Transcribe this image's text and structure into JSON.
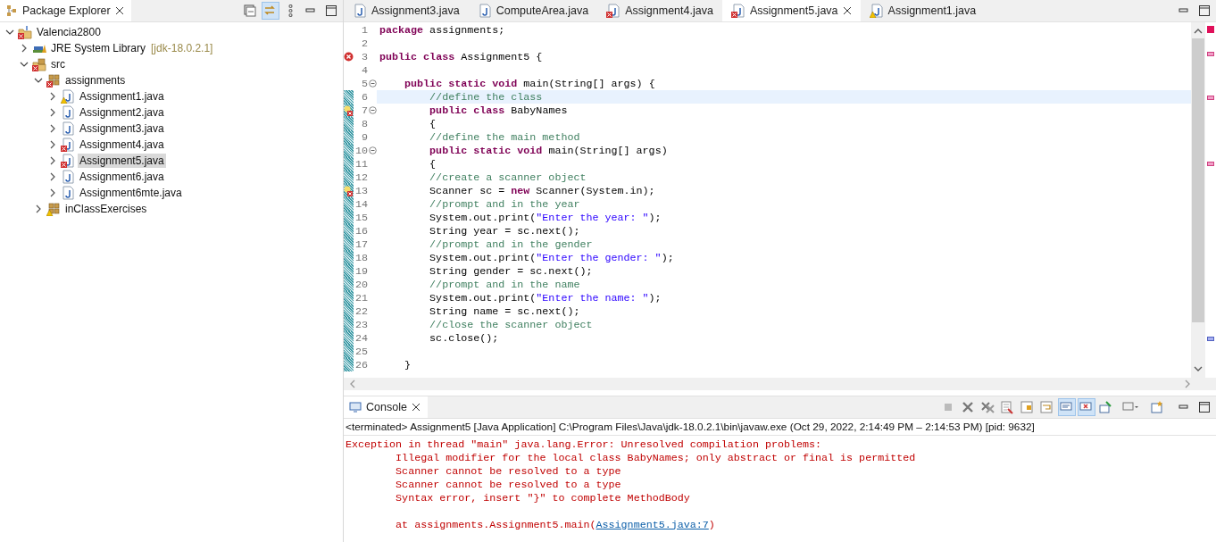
{
  "explorer": {
    "title": "Package Explorer",
    "toolbar": [
      {
        "kind": "collapse",
        "pressed": false
      },
      {
        "kind": "link",
        "pressed": true
      },
      {
        "kind": "menu",
        "pressed": false
      }
    ],
    "tree": [
      {
        "kind": "project",
        "label": "Valencia2800",
        "error": true,
        "warning": false,
        "expanded": true,
        "selected": false,
        "children": [
          {
            "kind": "library",
            "label": "JRE System Library",
            "suffix": "[jdk-18.0.2.1]",
            "error": false,
            "warning": false,
            "expanded": false,
            "selected": false
          },
          {
            "kind": "source",
            "label": "src",
            "error": true,
            "warning": false,
            "expanded": true,
            "selected": false,
            "children": [
              {
                "kind": "package",
                "label": "assignments",
                "error": true,
                "warning": false,
                "expanded": true,
                "selected": false,
                "children": [
                  {
                    "kind": "java",
                    "label": "Assignment1.java",
                    "error": false,
                    "warning": true,
                    "expanded": false,
                    "selected": false
                  },
                  {
                    "kind": "java",
                    "label": "Assignment2.java",
                    "error": false,
                    "warning": false,
                    "expanded": false,
                    "selected": false
                  },
                  {
                    "kind": "java",
                    "label": "Assignment3.java",
                    "error": false,
                    "warning": false,
                    "expanded": false,
                    "selected": false
                  },
                  {
                    "kind": "java",
                    "label": "Assignment4.java",
                    "error": true,
                    "warning": false,
                    "expanded": false,
                    "selected": false
                  },
                  {
                    "kind": "java",
                    "label": "Assignment5.java",
                    "error": true,
                    "warning": false,
                    "expanded": false,
                    "selected": true
                  },
                  {
                    "kind": "java",
                    "label": "Assignment6.java",
                    "error": false,
                    "warning": false,
                    "expanded": false,
                    "selected": false
                  },
                  {
                    "kind": "java",
                    "label": "Assignment6mte.java",
                    "error": false,
                    "warning": false,
                    "expanded": false,
                    "selected": false
                  }
                ]
              },
              {
                "kind": "package",
                "label": "inClassExercises",
                "error": false,
                "warning": true,
                "expanded": false,
                "selected": false
              }
            ]
          }
        ]
      }
    ]
  },
  "editor": {
    "tabs": [
      {
        "label": "Assignment3.java",
        "error": false,
        "warning": false,
        "selected": false
      },
      {
        "label": "ComputeArea.java",
        "error": false,
        "warning": false,
        "selected": false
      },
      {
        "label": "Assignment4.java",
        "error": true,
        "warning": false,
        "selected": false
      },
      {
        "label": "Assignment5.java",
        "error": true,
        "warning": false,
        "selected": true
      },
      {
        "label": "Assignment1.java",
        "error": false,
        "warning": true,
        "selected": false
      }
    ],
    "lines": [
      {
        "number": "1",
        "kind": "code",
        "text": "**package** assignments;",
        "error": false,
        "quickfix": false,
        "changed": false,
        "current": false,
        "fold": false
      },
      {
        "number": "2",
        "kind": "code",
        "error": false,
        "quickfix": false,
        "changed": false,
        "current": false,
        "fold": false
      },
      {
        "number": "3",
        "kind": "code",
        "text": "**public** **class** Assignment5 {",
        "error": true,
        "quickfix": false,
        "changed": false,
        "current": false,
        "fold": false
      },
      {
        "number": "4",
        "kind": "code",
        "error": false,
        "quickfix": false,
        "changed": false,
        "current": false,
        "fold": false
      },
      {
        "number": "5",
        "kind": "code",
        "text": "    **public** **static** **void** main(String[] args) {",
        "error": false,
        "quickfix": false,
        "changed": false,
        "current": false,
        "fold": true
      },
      {
        "number": "6",
        "kind": "comment",
        "text": "        //define the class",
        "error": false,
        "quickfix": false,
        "changed": true,
        "current": true,
        "fold": false
      },
      {
        "number": "7",
        "kind": "code",
        "text": "        **public** **class** BabyNames",
        "error": false,
        "quickfix": true,
        "changed": true,
        "current": false,
        "fold": true
      },
      {
        "number": "8",
        "kind": "code",
        "text": "        {",
        "error": false,
        "quickfix": false,
        "changed": true,
        "current": false,
        "fold": false
      },
      {
        "number": "9",
        "kind": "comment",
        "text": "        //define the main method",
        "error": false,
        "quickfix": false,
        "changed": true,
        "current": false,
        "fold": false
      },
      {
        "number": "10",
        "kind": "code",
        "text": "        **public** **static** **void** main(String[] args)",
        "error": false,
        "quickfix": false,
        "changed": true,
        "current": false,
        "fold": true
      },
      {
        "number": "11",
        "kind": "code",
        "text": "        {",
        "error": false,
        "quickfix": false,
        "changed": true,
        "current": false,
        "fold": false
      },
      {
        "number": "12",
        "kind": "comment",
        "text": "        //create a scanner object",
        "error": false,
        "quickfix": false,
        "changed": true,
        "current": false,
        "fold": false
      },
      {
        "number": "13",
        "kind": "code",
        "text": "        Scanner sc = **new** Scanner(System.in);",
        "error": false,
        "quickfix": true,
        "changed": true,
        "current": false,
        "fold": false
      },
      {
        "number": "14",
        "kind": "comment",
        "text": "        //prompt and in the year",
        "error": false,
        "quickfix": false,
        "changed": true,
        "current": false,
        "fold": false
      },
      {
        "number": "15",
        "kind": "code",
        "text": "        System.out.print(*\"Enter the year: \"*);",
        "error": false,
        "quickfix": false,
        "changed": true,
        "current": false,
        "fold": false
      },
      {
        "number": "16",
        "kind": "code",
        "text": "        String year = sc.next();",
        "error": false,
        "quickfix": false,
        "changed": true,
        "current": false,
        "fold": false
      },
      {
        "number": "17",
        "kind": "comment",
        "text": "        //prompt and in the gender",
        "error": false,
        "quickfix": false,
        "changed": true,
        "current": false,
        "fold": false
      },
      {
        "number": "18",
        "kind": "code",
        "text": "        System.out.print(*\"Enter the gender: \"*);",
        "error": false,
        "quickfix": false,
        "changed": true,
        "current": false,
        "fold": false
      },
      {
        "number": "19",
        "kind": "code",
        "text": "        String gender = sc.next();",
        "error": false,
        "quickfix": false,
        "changed": true,
        "current": false,
        "fold": false
      },
      {
        "number": "20",
        "kind": "comment",
        "text": "        //prompt and in the name",
        "error": false,
        "quickfix": false,
        "changed": true,
        "current": false,
        "fold": false
      },
      {
        "number": "21",
        "kind": "code",
        "text": "        System.out.print(*\"Enter the name: \"*);",
        "error": false,
        "quickfix": false,
        "changed": true,
        "current": false,
        "fold": false
      },
      {
        "number": "22",
        "kind": "code",
        "text": "        String name = sc.next();",
        "error": false,
        "quickfix": false,
        "changed": true,
        "current": false,
        "fold": false
      },
      {
        "number": "23",
        "kind": "comment",
        "text": "        //close the scanner object",
        "error": false,
        "quickfix": false,
        "changed": true,
        "current": false,
        "fold": false
      },
      {
        "number": "24",
        "kind": "code",
        "text": "        sc.close();",
        "error": false,
        "quickfix": false,
        "changed": true,
        "current": false,
        "fold": false
      },
      {
        "number": "25",
        "kind": "code",
        "error": false,
        "quickfix": false,
        "changed": true,
        "current": false,
        "fold": false
      },
      {
        "number": "26",
        "kind": "code",
        "text": "    }",
        "error": false,
        "quickfix": false,
        "changed": true,
        "current": false,
        "fold": false
      }
    ]
  },
  "console": {
    "title": "Console",
    "toolbar": [
      {
        "kind": "stop",
        "pressed": false
      },
      {
        "kind": "remove",
        "pressed": false
      },
      {
        "kind": "remove-all",
        "pressed": false
      },
      {
        "kind": "clear",
        "pressed": false
      },
      {
        "kind": "scroll-lock",
        "pressed": false
      },
      {
        "kind": "word-wrap",
        "pressed": false
      },
      {
        "kind": "show-out",
        "pressed": true
      },
      {
        "kind": "show-err",
        "pressed": true
      },
      {
        "kind": "pin",
        "pressed": false
      },
      {
        "kind": "display",
        "pressed": false
      },
      {
        "kind": "open",
        "pressed": false
      }
    ],
    "status": "<terminated> Assignment5 [Java Application] C:\\Program Files\\Java\\jdk-18.0.2.1\\bin\\javaw.exe  (Oct 29, 2022, 2:14:49 PM – 2:14:53 PM) [pid: 9632]",
    "output": [
      {
        "kind": "error",
        "text": "Exception in thread \"main\" java.lang.Error: Unresolved compilation problems: "
      },
      {
        "kind": "error",
        "text": "\tIllegal modifier for the local class BabyNames; only abstract or final is permitted"
      },
      {
        "kind": "error",
        "text": "\tScanner cannot be resolved to a type"
      },
      {
        "kind": "error",
        "text": "\tScanner cannot be resolved to a type"
      },
      {
        "kind": "error",
        "text": "\tSyntax error, insert \"}\" to complete MethodBody"
      },
      {
        "kind": "blank"
      },
      {
        "kind": "trace",
        "text": "\tat assignments.Assignment5.main(",
        "link": "Assignment5.java:7",
        "after": ")"
      }
    ]
  }
}
